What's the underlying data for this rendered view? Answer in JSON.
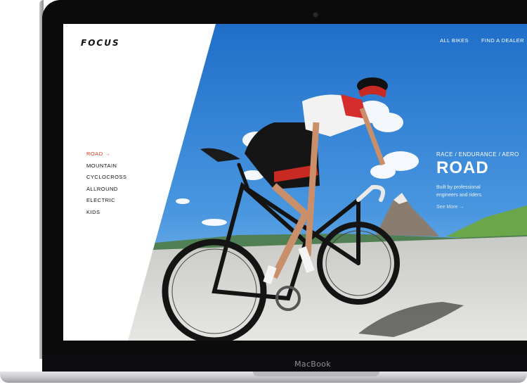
{
  "laptop": {
    "brand": "MacBook"
  },
  "site": {
    "logo": "FOCUS",
    "top_nav": [
      "ALL BIKES",
      "FIND A DEALER"
    ],
    "side_nav": [
      "ROAD →",
      "MOUNTAIN",
      "CYCLOCROSS",
      "ALLROUND",
      "ELECTRIC",
      "KIDS"
    ],
    "hero": {
      "kicker": "RACE / ENDURANCE / AERO",
      "title": "ROAD",
      "desc_line1": "Built by professional",
      "desc_line2": "engineers and riders.",
      "link": "See More →"
    }
  },
  "colors": {
    "accent": "#e03a1e",
    "sky": "#2f7fd0",
    "road": "#d9d9d6"
  }
}
